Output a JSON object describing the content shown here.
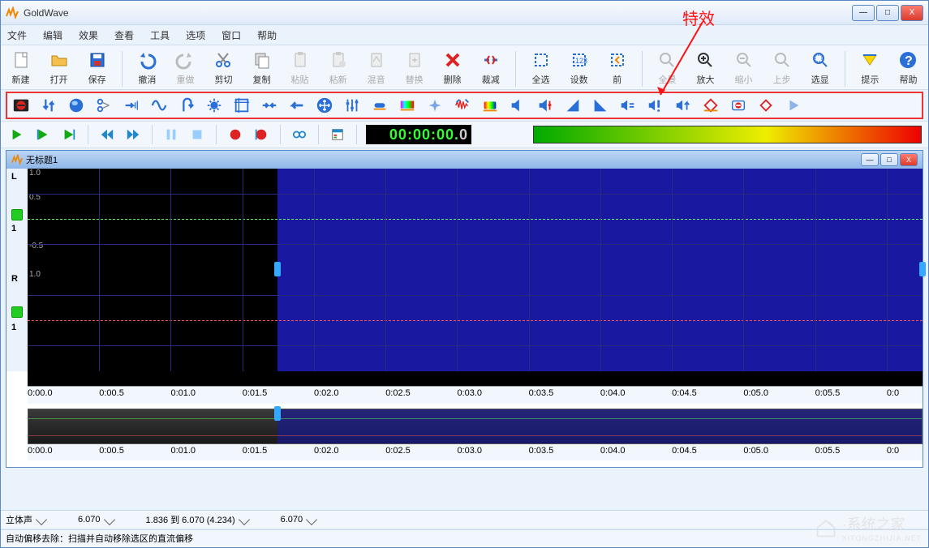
{
  "app": {
    "title": "GoldWave"
  },
  "window_controls": {
    "min": "—",
    "max": "□",
    "close": "X"
  },
  "menu": [
    "文件",
    "编辑",
    "效果",
    "查看",
    "工具",
    "选项",
    "窗口",
    "帮助"
  ],
  "toolbar": {
    "new": "新建",
    "open": "打开",
    "save": "保存",
    "undo": "撤消",
    "redo": "重做",
    "cut": "剪切",
    "copy": "复制",
    "paste": "粘贴",
    "pastenew": "粘新",
    "mix": "混音",
    "replace": "替换",
    "delete": "删除",
    "trim": "裁减",
    "selall": "全选",
    "setsel": "设数",
    "prev": "前",
    "fit": "全景",
    "zoomin": "放大",
    "zoomout": "缩小",
    "zoomsel": "上步",
    "findzoom": "选显",
    "tips": "提示",
    "help": "帮助"
  },
  "transport": {
    "time": "00:00:00.",
    "tenth": "0"
  },
  "annotation": {
    "label": "特效"
  },
  "doc": {
    "title": "无标题1",
    "left_label": "L",
    "right_label": "R",
    "one": "1",
    "amp_labels": [
      "1.0",
      "0.5",
      "-0.5",
      "1.0"
    ],
    "timeline": [
      "0:00.0",
      "0:00.5",
      "0:01.0",
      "0:01.5",
      "0:02.0",
      "0:02.5",
      "0:03.0",
      "0:03.5",
      "0:04.0",
      "0:04.5",
      "0:05.0",
      "0:05.5",
      "0:0"
    ],
    "selection_start_pct": 27.9,
    "selection_end_pct": 100
  },
  "bottom": {
    "channels": "立体声",
    "duration": "6.070",
    "selection": "1.836 到 6.070 (4.234)",
    "pos": "6.070"
  },
  "status": "自动偏移去除：扫描并自动移除选区的直流偏移",
  "watermark": {
    "text": "·系统之家",
    "sub": "XITONGZHIJIA.NET"
  }
}
